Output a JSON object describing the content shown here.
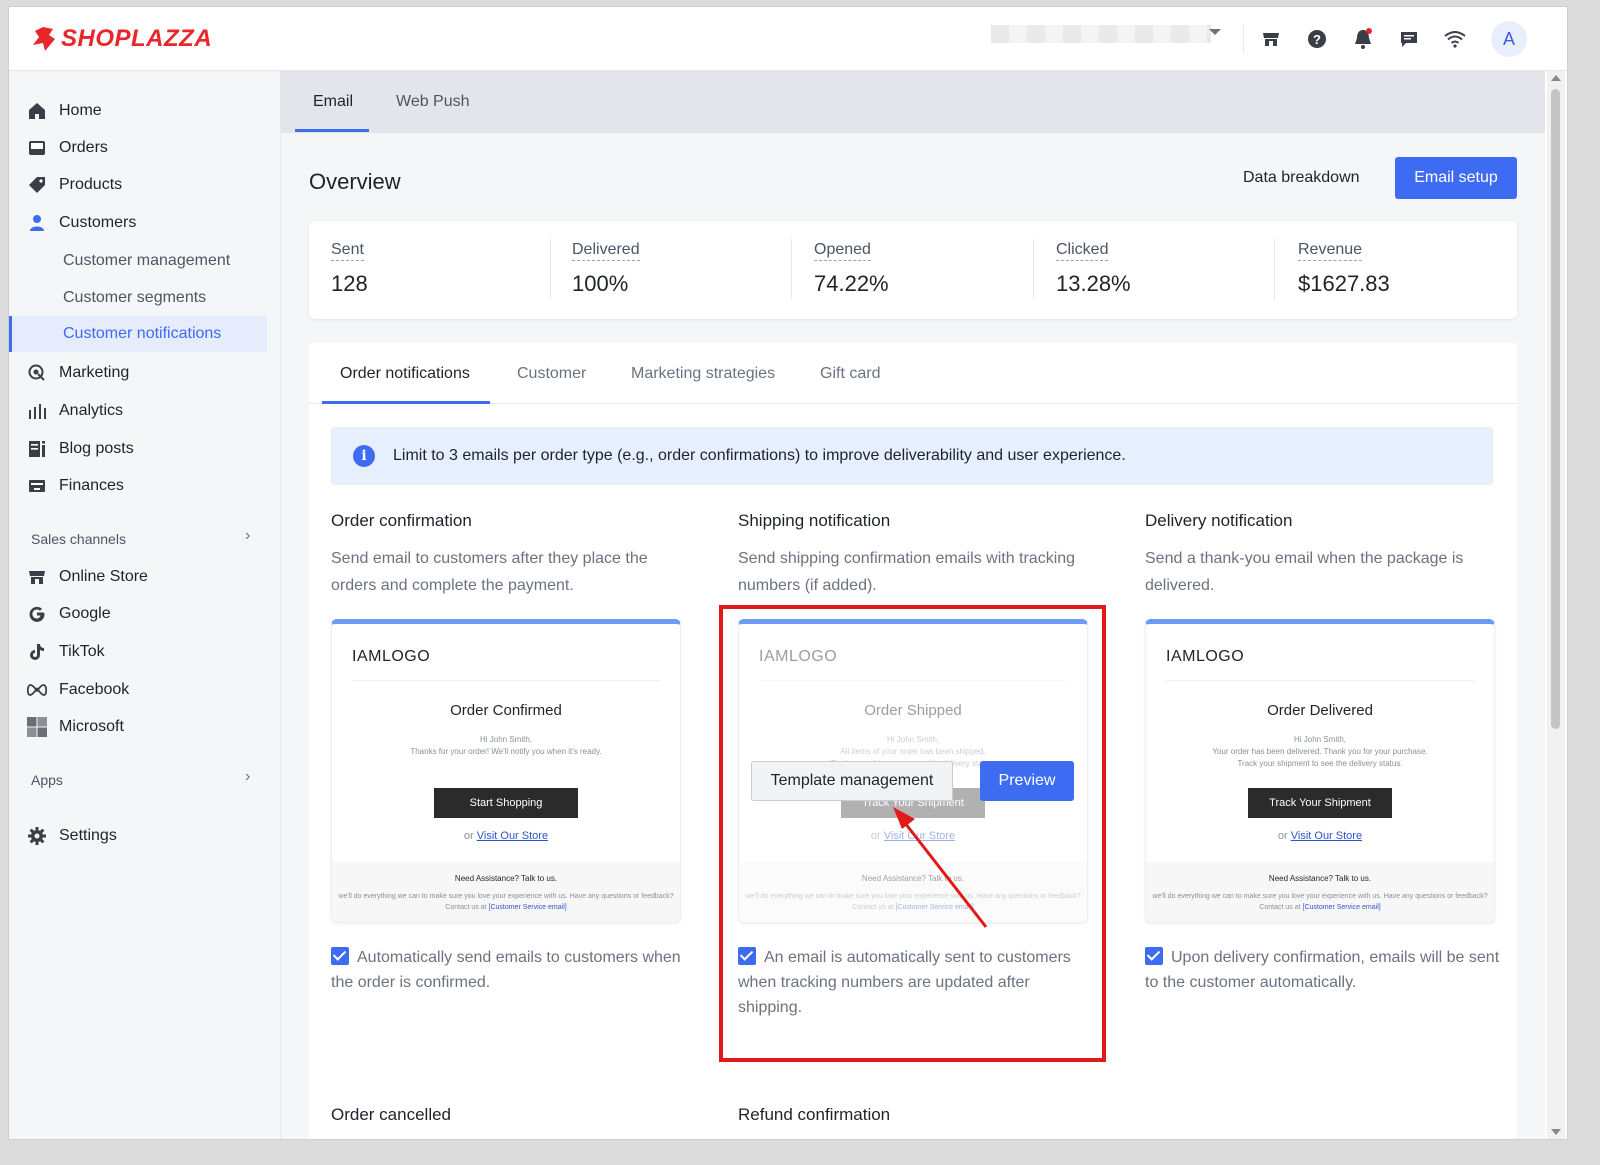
{
  "brand": {
    "name": "SHOPLAZZA",
    "color": "#e8262b"
  },
  "topbar": {
    "store_selector_icon": "chevron-down-icon",
    "icons": [
      "store-icon",
      "help-icon",
      "bell-icon",
      "chat-icon",
      "wifi-icon"
    ],
    "avatar_initial": "A"
  },
  "sidebar": {
    "items": [
      {
        "label": "Home",
        "icon": "home-icon"
      },
      {
        "label": "Orders",
        "icon": "inbox-icon"
      },
      {
        "label": "Products",
        "icon": "tag-icon"
      },
      {
        "label": "Customers",
        "icon": "user-icon"
      }
    ],
    "customer_sub": [
      "Customer management",
      "Customer segments",
      "Customer notifications"
    ],
    "items2": [
      {
        "label": "Marketing",
        "icon": "marketing-icon"
      },
      {
        "label": "Analytics",
        "icon": "bar-chart-icon"
      },
      {
        "label": "Blog posts",
        "icon": "blog-icon"
      },
      {
        "label": "Finances",
        "icon": "finance-icon"
      }
    ],
    "sales_channels_label": "Sales channels",
    "channels": [
      {
        "label": "Online Store",
        "icon": "store-icon"
      },
      {
        "label": "Google",
        "icon": "google-icon"
      },
      {
        "label": "TikTok",
        "icon": "tiktok-icon"
      },
      {
        "label": "Facebook",
        "icon": "meta-icon"
      },
      {
        "label": "Microsoft",
        "icon": "microsoft-icon"
      }
    ],
    "apps_label": "Apps",
    "settings_label": "Settings",
    "accent": "#3d6bf2"
  },
  "tabs": {
    "email": "Email",
    "web_push": "Web Push"
  },
  "overview": {
    "title": "Overview",
    "data_breakdown": "Data breakdown",
    "email_setup": "Email setup"
  },
  "stats": [
    {
      "label": "Sent",
      "value": "128"
    },
    {
      "label": "Delivered",
      "value": "100%"
    },
    {
      "label": "Opened",
      "value": "74.22%"
    },
    {
      "label": "Clicked",
      "value": "13.28%"
    },
    {
      "label": "Revenue",
      "value": "$1627.83"
    }
  ],
  "panel_tabs": [
    "Order notifications",
    "Customer",
    "Marketing strategies",
    "Gift card"
  ],
  "info_banner": "Limit to 3 emails per order type (e.g., order confirmations) to improve deliverability and user experience.",
  "notifications": [
    {
      "title": "Order confirmation",
      "desc": "Send email to customers after they place the orders and complete the payment.",
      "card": {
        "logo": "IAMLOGO",
        "heading": "Order Confirmed",
        "line1": "Hi John Smith,",
        "line2": "Thanks for your order! We'll notify you when it's ready.",
        "line3": "",
        "button": "Start Shopping",
        "or": "or",
        "link": "Visit Our Store",
        "foot_title": "Need Assistance? Talk to us.",
        "foot_text": "we'll do everything we can to make sure you love your experience with us. Have any questions or feedback? Contact us at",
        "foot_link": "[Customer Service email]"
      },
      "checkbox": "Automatically send emails to customers when the order is confirmed."
    },
    {
      "title": "Shipping notification",
      "desc": "Send shipping confirmation emails with tracking numbers (if added).",
      "card": {
        "logo": "IAMLOGO",
        "heading": "Order Shipped",
        "line1": "Hi John Smith,",
        "line2": "All items of your order has been shipped.",
        "line3": "Track your shipment to see the delivery status.",
        "button": "Track Your Shipment",
        "or": "or",
        "link": "Visit Our Store",
        "foot_title": "Need Assistance? Talk to us.",
        "foot_text": "we'll do everything we can to make sure you love your experience with us. Have any questions or feedback? Contact us at",
        "foot_link": "[Customer Service email]"
      },
      "checkbox": "An email is automatically sent to customers when tracking numbers are updated after shipping."
    },
    {
      "title": "Delivery notification",
      "desc": "Send a thank-you email when the package is delivered.",
      "card": {
        "logo": "IAMLOGO",
        "heading": "Order Delivered",
        "line1": "Hi John Smith,",
        "line2": "Your order has been delivered. Thank you for your purchase.",
        "line3": "Track your shipment to see the delivery status.",
        "button": "Track Your Shipment",
        "or": "or",
        "link": "Visit Our Store",
        "foot_title": "Need Assistance? Talk to us.",
        "foot_text": "we'll do everything we can to make sure you love your experience with us. Have any questions or feedback? Contact us at",
        "foot_link": "[Customer Service email]"
      },
      "checkbox": "Upon delivery confirmation, emails will be sent to the customer automatically."
    }
  ],
  "overlay": {
    "template_management": "Template management",
    "preview": "Preview"
  },
  "bottom_titles": [
    "Order cancelled",
    "Refund confirmation"
  ],
  "annotation_color": "#e11919"
}
